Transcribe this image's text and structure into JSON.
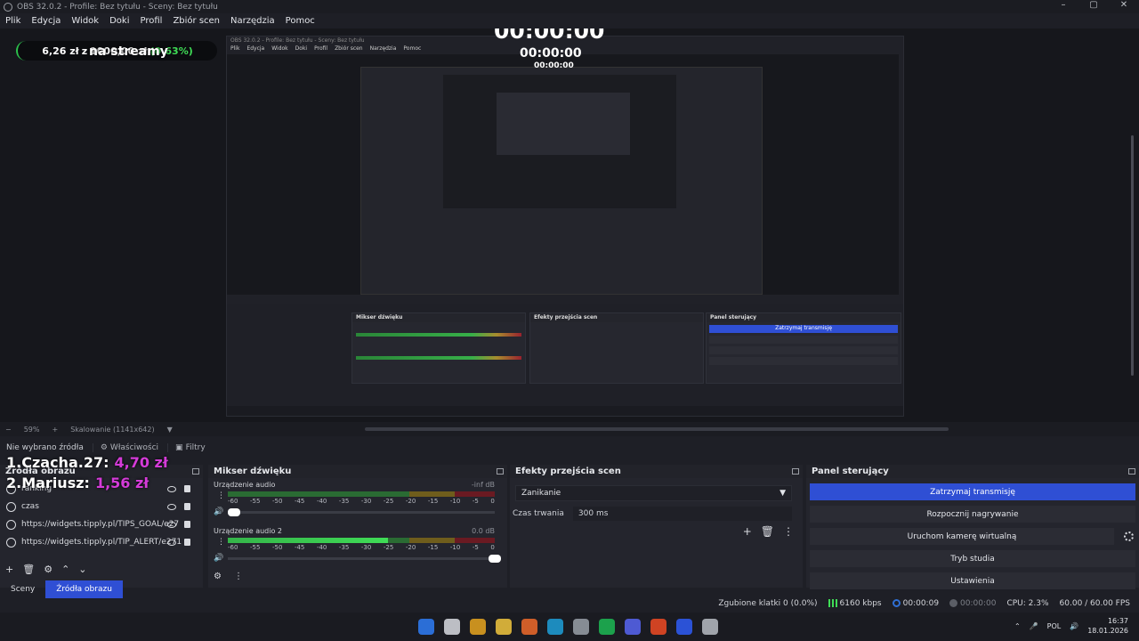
{
  "window": {
    "title": "OBS 32.0.2 - Profile: Bez tytułu - Sceny: Bez tytułu",
    "controls": [
      "–",
      "▢",
      "✕"
    ]
  },
  "menu": [
    "Plik",
    "Edycja",
    "Widok",
    "Doki",
    "Profil",
    "Zbiór scen",
    "Narzędzia",
    "Pomoc"
  ],
  "overlay": {
    "goal_title": "na streamy",
    "goal_amount": "6,26 zł",
    "goal_of": "z",
    "goal_target": "1000,00 zł",
    "goal_percent": "(0.63%)",
    "goal_progress": 0.0063,
    "timer": "00:00:00",
    "top_donors": [
      {
        "name": "1.Czacha.27:",
        "amount": "4,70 zł"
      },
      {
        "name": "2.Mariusz:",
        "amount": "1,56 zł"
      }
    ]
  },
  "nested": {
    "title": "OBS 32.0.2 - Profile: Bez tytułu - Sceny: Bez tytułu",
    "menu": [
      "Plik",
      "Edycja",
      "Widok",
      "Doki",
      "Profil",
      "Zbiór scen",
      "Narzędzia",
      "Pomoc"
    ],
    "panels": [
      "Mikser dźwięku",
      "Efekty przejścia scen",
      "Panel sterujący"
    ],
    "stream_btn": "Zatrzymaj transmisję"
  },
  "zoom": {
    "percent": "59%",
    "scaling": "Skalowanie (1141x642)"
  },
  "source_info": {
    "label": "Nie wybrano źródła",
    "properties": "Właściwości",
    "filters": "Filtry"
  },
  "sources": {
    "title": "Źródła obrazu",
    "items": [
      {
        "name": "ranking"
      },
      {
        "name": "czas"
      },
      {
        "name": "https://widgets.tipply.pl/TIPS_GOAL/e27"
      },
      {
        "name": "https://widgets.tipply.pl/TIP_ALERT/e271"
      }
    ],
    "toolbar": [
      "+",
      "🗑",
      "⚙",
      "⌃",
      "⌄"
    ]
  },
  "tabs": {
    "scenes": "Sceny",
    "sources": "Źródła obrazu"
  },
  "mixer": {
    "title": "Mikser dźwięku",
    "channels": [
      {
        "name": "Urządzenie audio",
        "db": "-inf dB",
        "level": 0.0,
        "volume": 0.02
      },
      {
        "name": "Urządzenie audio 2",
        "db": "0.0 dB",
        "level": 0.6,
        "volume": 1.0
      }
    ],
    "ticks": [
      "-60",
      "-55",
      "-50",
      "-45",
      "-40",
      "-35",
      "-30",
      "-25",
      "-20",
      "-15",
      "-10",
      "-5",
      "0"
    ]
  },
  "transitions": {
    "title": "Efekty przejścia scen",
    "selected": "Zanikanie",
    "duration_label": "Czas trwania",
    "duration_value": "300 ms"
  },
  "controls": {
    "title": "Panel sterujący",
    "stop_stream": "Zatrzymaj transmisję",
    "start_record": "Rozpocznij nagrywanie",
    "virtual_cam": "Uruchom kamerę wirtualną",
    "studio_mode": "Tryb studia",
    "settings": "Ustawienia"
  },
  "status": {
    "dropped": "Zgubione klatki 0 (0.0%)",
    "bitrate": "6160 kbps",
    "live_time": "00:00:09",
    "rec_time": "00:00:00",
    "cpu": "CPU: 2.3%",
    "fps": "60.00 / 60.00 FPS"
  },
  "taskbar": {
    "lang": "POL",
    "time": "16:37",
    "date": "18.01.2026",
    "app_colors": [
      "#2f7cf6",
      "#d9dbe0",
      "#e8a51e",
      "#f2c53d",
      "#f06a2a",
      "#1f9fd8",
      "#9aa0a8",
      "#1db954",
      "#5865f2",
      "#f04a23",
      "#2f5cf6",
      "#b9bcc3"
    ]
  }
}
